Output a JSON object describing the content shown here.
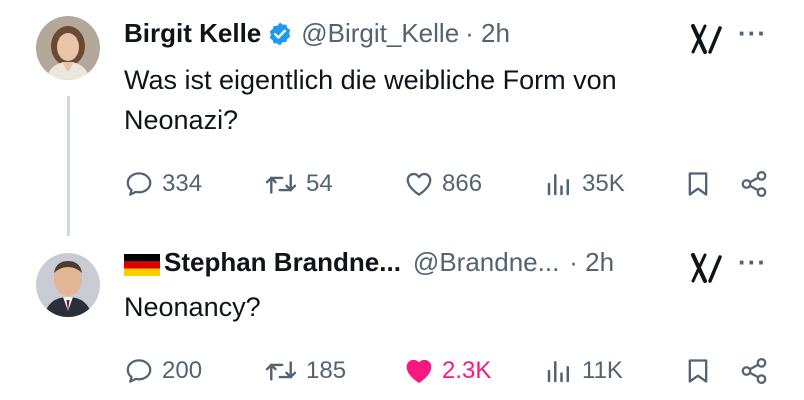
{
  "tweets": [
    {
      "author_name": "Birgit Kelle",
      "handle": "@Birgit_Kelle",
      "time": "· 2h",
      "verified": true,
      "text_lines": [
        "Was ist eigentlich die weibliche Form von",
        "Neonazi?"
      ],
      "replies": "334",
      "retweets": "54",
      "likes": "866",
      "views": "35K",
      "liked": false,
      "icons": [
        "reply-icon",
        "retweet-icon",
        "heart-icon",
        "views-icon",
        "bookmark-icon",
        "share-icon",
        "grok-icon",
        "more-icon"
      ]
    },
    {
      "author_name": "Stephan Brandne...",
      "handle": "@Brandne...",
      "time": "· 2h",
      "verified": false,
      "flag": "germany",
      "text_lines": [
        "Neonancy?"
      ],
      "replies": "200",
      "retweets": "185",
      "likes": "2.3K",
      "views": "11K",
      "liked": true,
      "icons": [
        "reply-icon",
        "retweet-icon",
        "heart-filled-icon",
        "views-icon",
        "bookmark-icon",
        "share-icon",
        "grok-icon",
        "more-icon"
      ]
    }
  ],
  "more_label": "···",
  "colors": {
    "text": "#0f1419",
    "secondary": "#536471",
    "verified_blue": "#1d9bf0",
    "like_pink": "#f91880",
    "thread_line": "#cfd9de"
  }
}
